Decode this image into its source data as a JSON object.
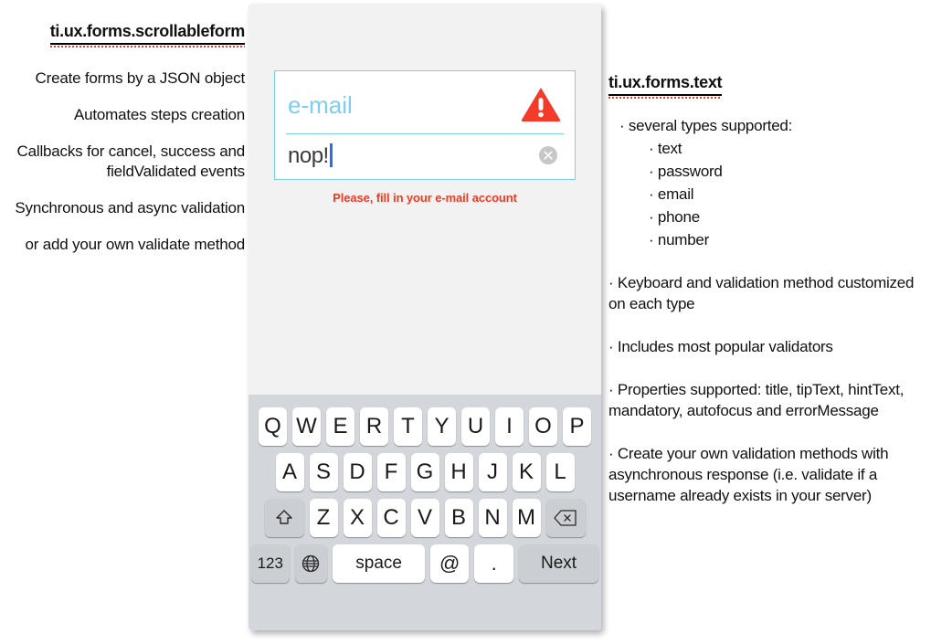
{
  "left_column": {
    "heading": "ti.ux.forms.scrollableform",
    "lines": [
      "Create forms by a JSON object",
      "Automates steps creation",
      "Callbacks for cancel, success and fieldValidated events",
      "Synchronous and async validation",
      "or add your own validate method"
    ]
  },
  "right_column": {
    "heading": "ti.ux.forms.text",
    "bullets": [
      "· several types supported:",
      "· text",
      "· password",
      "· email",
      "· phone",
      "· number",
      "· Keyboard and validation method customized on each type",
      "· Includes most popular validators",
      "· Properties supported: title, tipText, hintText, mandatory, autofocus and errorMessage",
      "· Create your own validation methods with asynchronous response (i.e. validate if a username already exists in your server)"
    ]
  },
  "phone": {
    "form": {
      "field_label": "e-mail",
      "field_value": "nop!",
      "error_message": "Please, fill in your e-mail account",
      "warning_icon": "warning-triangle-icon",
      "clear_icon": "clear-circle-icon"
    },
    "keyboard": {
      "row1": [
        "Q",
        "W",
        "E",
        "R",
        "T",
        "Y",
        "U",
        "I",
        "O",
        "P"
      ],
      "row2": [
        "A",
        "S",
        "D",
        "F",
        "G",
        "H",
        "J",
        "K",
        "L"
      ],
      "row3": [
        "Z",
        "X",
        "C",
        "V",
        "B",
        "N",
        "M"
      ],
      "shift_key": "⇧",
      "delete_key": "⌫",
      "numbers_key": "123",
      "globe_key": "🌐",
      "space_key": "space",
      "at_key": "@",
      "dot_key": ".",
      "next_key": "Next"
    }
  },
  "colors": {
    "accent_blue": "#7ecdf0",
    "error_red": "#f03a21",
    "cursor_blue": "#2b6df0",
    "keyboard_bg": "#d3d7dc",
    "key_gray": "#cbced2",
    "phone_bg": "#f2f2f2"
  }
}
